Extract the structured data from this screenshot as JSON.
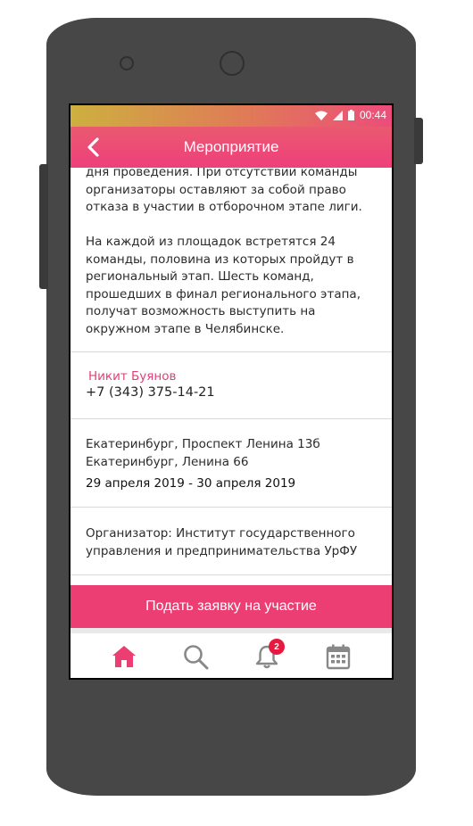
{
  "status_bar": {
    "time": "00:44"
  },
  "header": {
    "title": "Мероприятие"
  },
  "description": {
    "paragraph1_lines": [
      "дня проведения. При отсутствии команды",
      "организаторы оставляют за собой право",
      "отказа в участии в отборочном этапе лиги."
    ],
    "paragraph2_lines": [
      "На каждой из площадок встретятся 24",
      "команды, половина из которых пройдут в",
      "региональный этап. Шесть команд,",
      "прошедших в финал регионального этапа,",
      "получат возможность выступить на",
      "окружном этапе в Челябинске."
    ]
  },
  "contact": {
    "name": "Никит Буянов",
    "phone": "+7 (343) 375-14-21"
  },
  "location": {
    "address1": "Екатеринбург, Проспект Ленина 13б",
    "address2": "Екатеринбург, Ленина 66",
    "dates": "29 апреля 2019 - 30 апреля 2019"
  },
  "organizer": {
    "line1": "Организатор: Институт государственного",
    "line2": "управления и предпринимательства УрФУ"
  },
  "apply_button": {
    "label": "Подать заявку на участие"
  },
  "tabbar": {
    "items": [
      {
        "icon": "home-icon",
        "active": true
      },
      {
        "icon": "search-icon",
        "active": false
      },
      {
        "icon": "bell-icon",
        "active": false,
        "badge": "2"
      },
      {
        "icon": "calendar-icon",
        "active": false
      }
    ]
  },
  "colors": {
    "accent": "#ed3e73",
    "inactive_icon": "#888888",
    "badge": "#e8193f"
  }
}
